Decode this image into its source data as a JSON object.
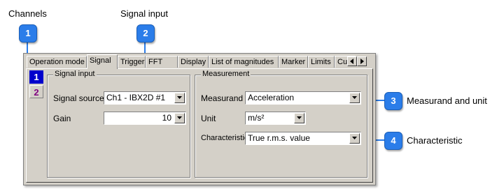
{
  "callouts": {
    "channels_title": "Channels",
    "signal_input_title": "Signal input",
    "badge1": "1",
    "badge2": "2",
    "badge3": "3",
    "badge4": "4",
    "measurand_unit_label": "Measurand and unit",
    "characteristic_label": "Characteristic",
    "badge_color": "#2b7de9"
  },
  "tabs": [
    "Operation mode",
    "Signal",
    "Trigger",
    "FFT",
    "Display",
    "List of magnitudes",
    "Marker",
    "Limits",
    "Cur"
  ],
  "active_tab": "Signal",
  "side_tabs": [
    "1",
    "2"
  ],
  "signal_input": {
    "group_label": "Signal input",
    "source_label": "Signal source",
    "source_value": "Ch1 - IBX2D #1",
    "gain_label": "Gain",
    "gain_value": "10"
  },
  "measurement": {
    "group_label": "Measurement",
    "measurand_label": "Measurand",
    "measurand_value": "Acceleration",
    "unit_label": "Unit",
    "unit_value": "m/s²",
    "characteristic_label": "Characteristic",
    "characteristic_value": "True r.m.s. value"
  }
}
